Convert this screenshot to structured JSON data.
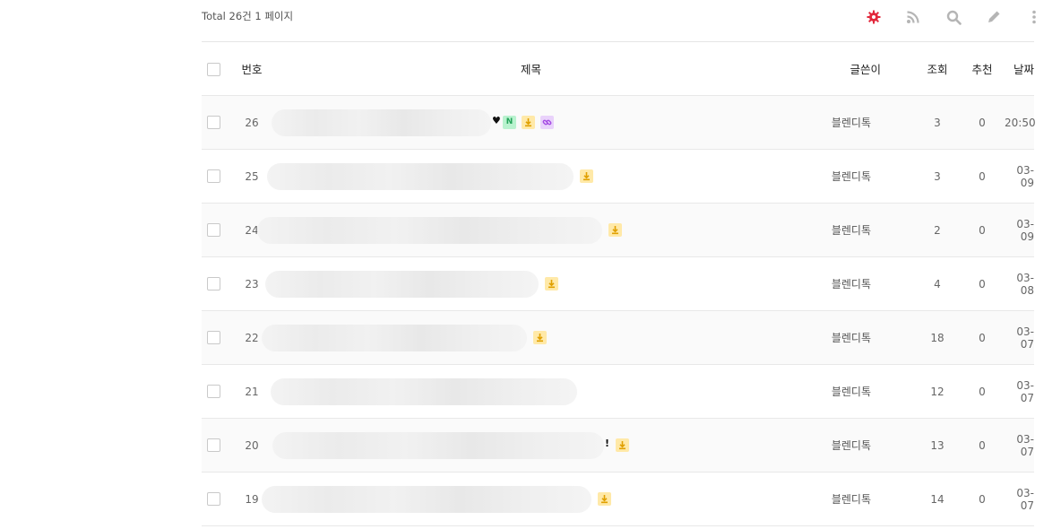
{
  "header": {
    "total_text": "Total 26건 1 페이지",
    "tools": [
      {
        "name": "admin-gear-icon",
        "color": "#e2283c"
      },
      {
        "name": "rss-icon",
        "color": "#b5b5b5"
      },
      {
        "name": "search-icon",
        "color": "#b5b5b5"
      },
      {
        "name": "write-pencil-icon",
        "color": "#b5b5b5"
      },
      {
        "name": "more-vertical-icon",
        "color": "#b5b5b5"
      }
    ]
  },
  "columns": {
    "num": "번호",
    "subject": "제목",
    "writer": "글쓴이",
    "views": "조회",
    "recommend": "추천",
    "date": "날짜"
  },
  "rows": [
    {
      "num": "26",
      "writer": "블렌디톡",
      "views": "3",
      "recommend": "0",
      "date": "20:50",
      "mark": "♥",
      "badges": [
        "new",
        "file",
        "link"
      ]
    },
    {
      "num": "25",
      "writer": "블렌디톡",
      "views": "3",
      "recommend": "0",
      "date": "03-09",
      "mark": "",
      "badges": [
        "file"
      ]
    },
    {
      "num": "24",
      "writer": "블렌디톡",
      "views": "2",
      "recommend": "0",
      "date": "03-09",
      "mark": "",
      "badges": [
        "file"
      ]
    },
    {
      "num": "23",
      "writer": "블렌디톡",
      "views": "4",
      "recommend": "0",
      "date": "03-08",
      "mark": "",
      "badges": [
        "file"
      ]
    },
    {
      "num": "22",
      "writer": "블렌디톡",
      "views": "18",
      "recommend": "0",
      "date": "03-07",
      "mark": "",
      "badges": [
        "file"
      ]
    },
    {
      "num": "21",
      "writer": "블렌디톡",
      "views": "12",
      "recommend": "0",
      "date": "03-07",
      "mark": "",
      "badges": []
    },
    {
      "num": "20",
      "writer": "블렌디톡",
      "views": "13",
      "recommend": "0",
      "date": "03-07",
      "mark": "!",
      "badges": [
        "file"
      ]
    },
    {
      "num": "19",
      "writer": "블렌디톡",
      "views": "14",
      "recommend": "0",
      "date": "03-07",
      "mark": "",
      "badges": [
        "file"
      ]
    }
  ],
  "badge_labels": {
    "new": "N"
  }
}
